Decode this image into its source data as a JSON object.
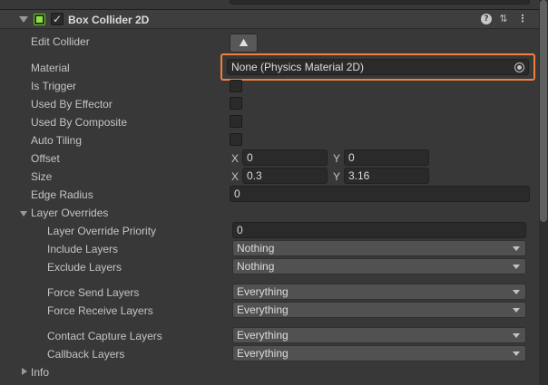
{
  "component": {
    "title": "Box Collider 2D",
    "enabled": true,
    "icons": [
      "box-collider-2d-icon",
      "help-icon",
      "presets-icon",
      "context-menu-icon"
    ]
  },
  "rows": {
    "edit_collider": {
      "label": "Edit Collider",
      "button_glyph": "⛰"
    },
    "material": {
      "label": "Material",
      "value": "None (Physics Material 2D)"
    },
    "is_trigger": {
      "label": "Is Trigger"
    },
    "used_by_effector": {
      "label": "Used By Effector"
    },
    "used_by_composite": {
      "label": "Used By Composite"
    },
    "auto_tiling": {
      "label": "Auto Tiling"
    },
    "offset": {
      "label": "Offset",
      "x_label": "X",
      "x": "0",
      "y_label": "Y",
      "y": "0"
    },
    "size": {
      "label": "Size",
      "x_label": "X",
      "x": "0.3",
      "y_label": "Y",
      "y": "3.16"
    },
    "edge_radius": {
      "label": "Edge Radius",
      "value": "0"
    },
    "layer_overrides": {
      "label": "Layer Overrides",
      "priority": {
        "label": "Layer Override Priority",
        "value": "0"
      },
      "include": {
        "label": "Include Layers",
        "value": "Nothing"
      },
      "exclude": {
        "label": "Exclude Layers",
        "value": "Nothing"
      },
      "force_send": {
        "label": "Force Send Layers",
        "value": "Everything"
      },
      "force_receive": {
        "label": "Force Receive Layers",
        "value": "Everything"
      },
      "contact_capture": {
        "label": "Contact Capture Layers",
        "value": "Everything"
      },
      "callback": {
        "label": "Callback Layers",
        "value": "Everything"
      }
    },
    "info": {
      "label": "Info"
    }
  },
  "colors": {
    "background": "#383838",
    "field": "#2a2a2a",
    "dropdown": "#515151",
    "highlight": "#f0803c",
    "component_icon": "#8be043"
  }
}
